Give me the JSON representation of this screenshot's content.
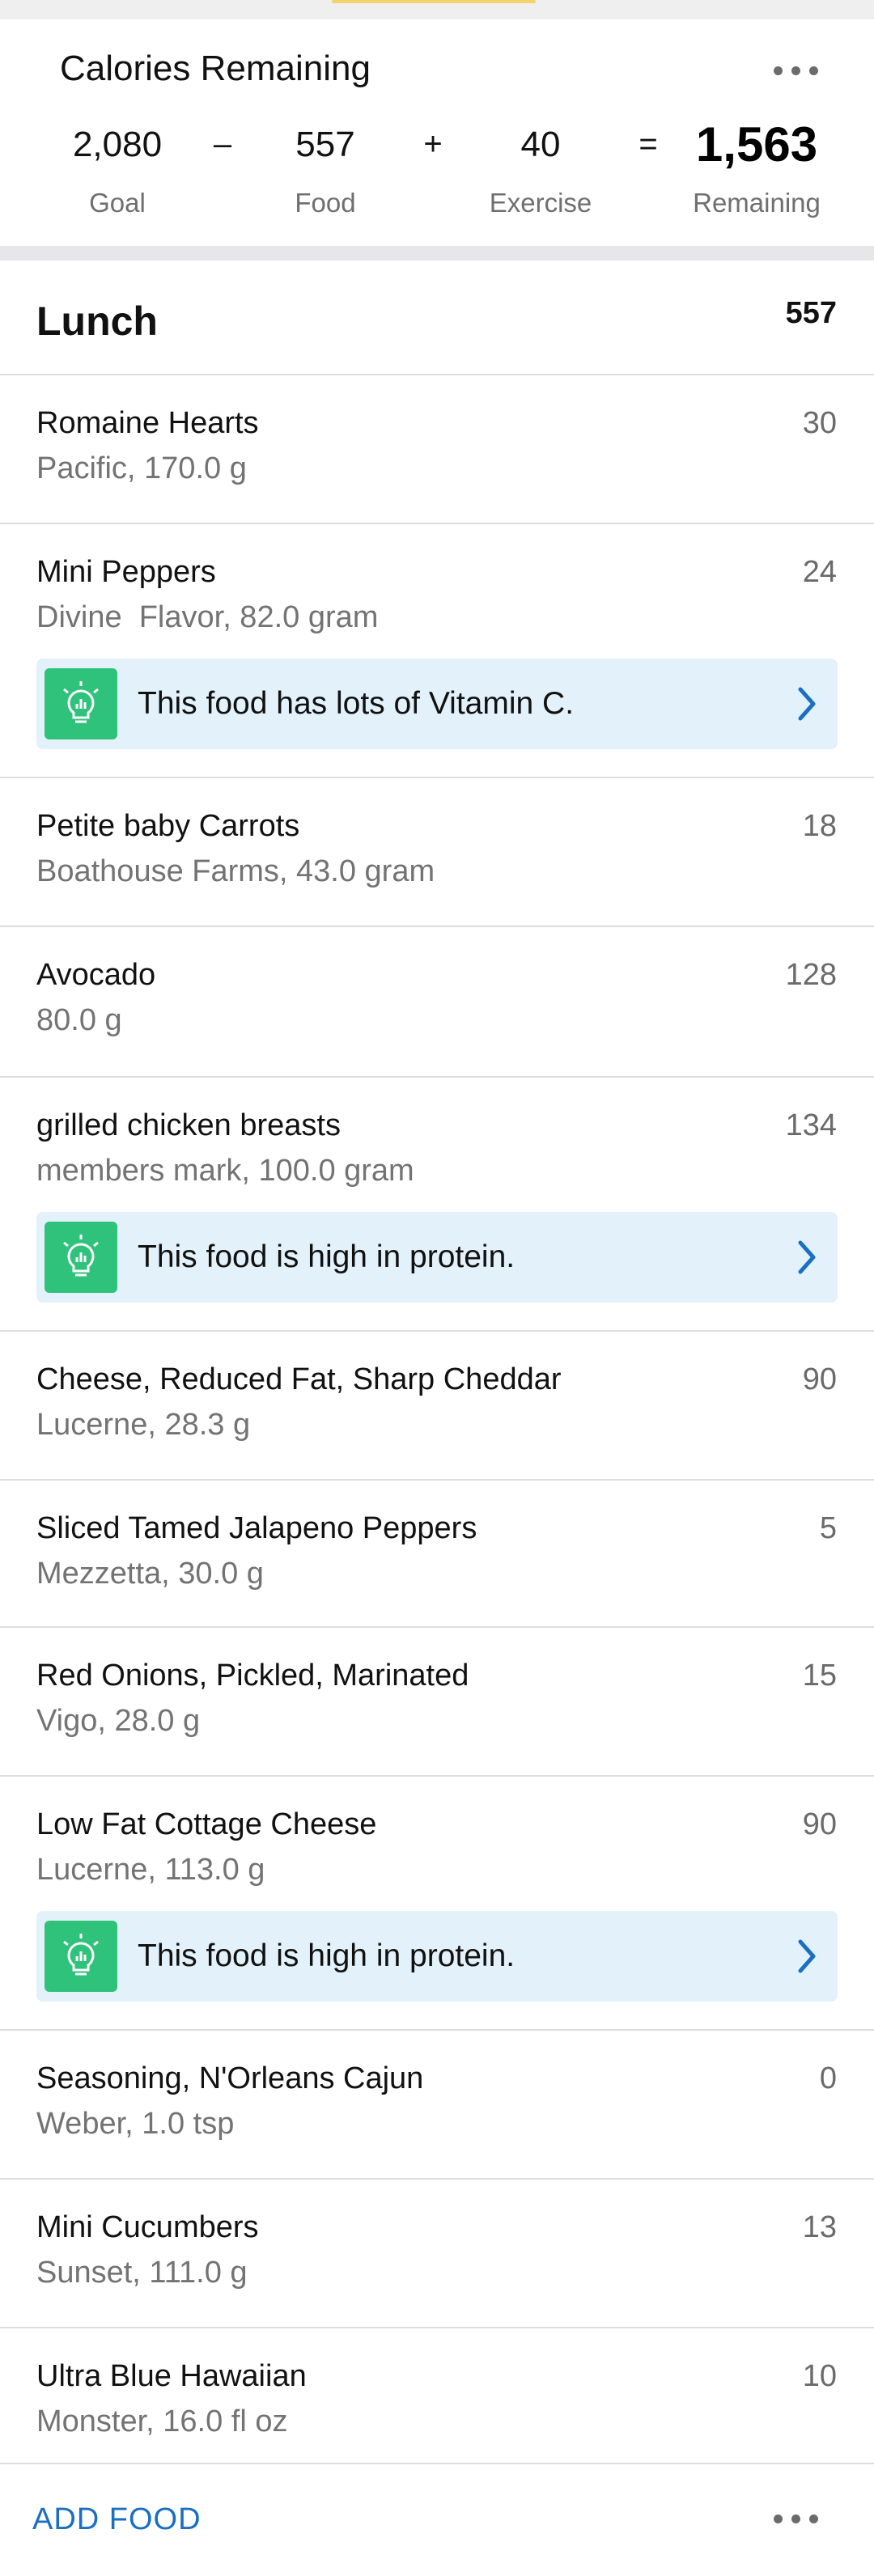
{
  "summary": {
    "title": "Calories Remaining",
    "goal_value": "2,080",
    "goal_label": "Goal",
    "minus": "–",
    "food_value": "557",
    "food_label": "Food",
    "plus": "+",
    "exercise_value": "40",
    "exercise_label": "Exercise",
    "equals": "=",
    "remaining_value": "1,563",
    "remaining_label": "Remaining",
    "menu_icon": "more-horizontal-icon"
  },
  "meal": {
    "name": "Lunch",
    "calories": "557",
    "items": [
      {
        "name": "Romaine Hearts",
        "detail": "Pacific, 170.0 g",
        "calories": "30"
      },
      {
        "name": "Mini Peppers",
        "detail": "Divine  Flavor, 82.0 gram",
        "calories": "24",
        "tip": "This food has lots of Vitamin C."
      },
      {
        "name": "Petite baby Carrots",
        "detail": "Boathouse Farms, 43.0 gram",
        "calories": "18"
      },
      {
        "name": "Avocado",
        "detail": "80.0 g",
        "calories": "128"
      },
      {
        "name": "grilled chicken breasts",
        "detail": "members mark, 100.0 gram",
        "calories": "134",
        "tip": "This food is high in protein."
      },
      {
        "name": "Cheese, Reduced Fat, Sharp Cheddar",
        "detail": "Lucerne, 28.3 g",
        "calories": "90"
      },
      {
        "name": "Sliced Tamed Jalapeno Peppers",
        "detail": "Mezzetta, 30.0 g",
        "calories": "5"
      },
      {
        "name": "Red Onions, Pickled, Marinated",
        "detail": "Vigo, 28.0 g",
        "calories": "15"
      },
      {
        "name": "Low Fat Cottage Cheese",
        "detail": "Lucerne, 113.0 g",
        "calories": "90",
        "tip": "This food is high in protein."
      },
      {
        "name": "Seasoning, N'Orleans Cajun",
        "detail": "Weber, 1.0 tsp",
        "calories": "0"
      },
      {
        "name": "Mini Cucumbers",
        "detail": "Sunset, 111.0 g",
        "calories": "13"
      },
      {
        "name": "Ultra Blue Hawaiian",
        "detail": "Monster, 16.0 fl oz",
        "calories": "10"
      }
    ]
  },
  "footer": {
    "add_food": "ADD FOOD",
    "menu_icon": "more-horizontal-icon"
  },
  "colors": {
    "accent_blue": "#1a6fc3",
    "tip_background": "#e2f1fa",
    "tip_badge_green": "#2fc27a",
    "secondary_text": "#737373"
  }
}
